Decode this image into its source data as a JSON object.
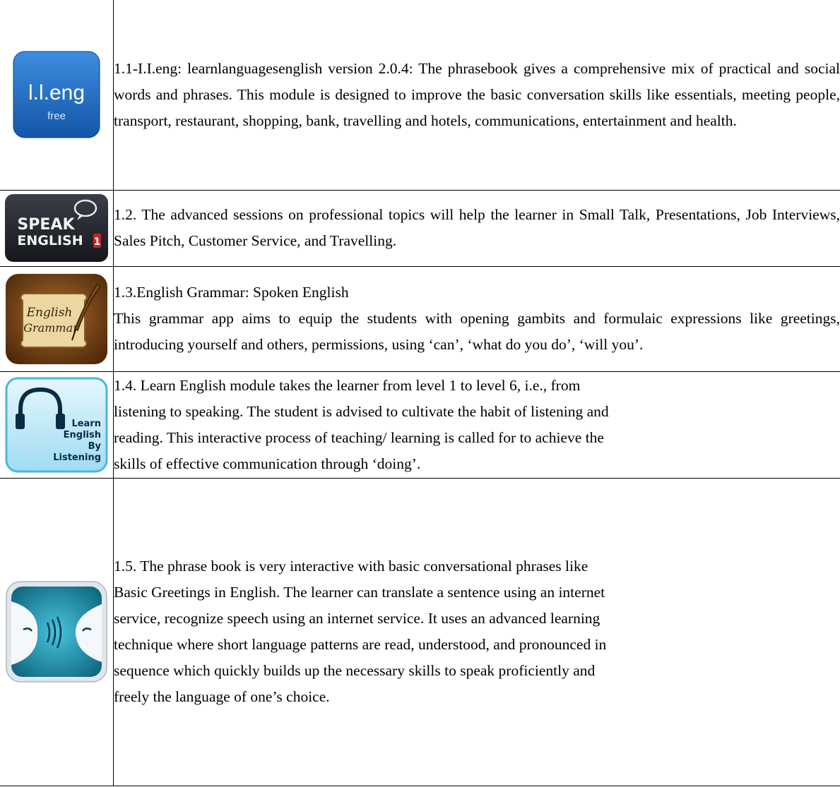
{
  "rows": [
    {
      "icon": "lleng-free-app-icon",
      "icon_title": "l.l.eng",
      "icon_subtitle": "free",
      "text_lines": [
        "1.1-I.I.eng: learnlanguagesenglish version 2.0.4: The phrasebook gives a comprehensive mix of practical and social words and phrases. This module is designed to improve the basic conversation skills like essentials, meeting people, transport, restaurant, shopping, bank, travelling and hotels, communications, entertainment and health."
      ]
    },
    {
      "icon": "speak-english-app-icon",
      "icon_line1": "SPEAK",
      "icon_line2": "ENGLISH",
      "icon_badge": "1",
      "text_lines": [
        "1.2. The advanced sessions on professional topics will help the learner in Small Talk, Presentations, Job Interviews, Sales Pitch, Customer Service, and Travelling."
      ]
    },
    {
      "icon": "english-grammar-scroll-app-icon",
      "icon_line1": "English",
      "icon_line2": "Grammar",
      "text_lines": [
        "1.3.English Grammar: Spoken English",
        "This grammar app aims to equip the students with opening gambits and formulaic expressions like greetings, introducing yourself and others, permissions, using ‘can’, ‘what do you do’, ‘will you’."
      ]
    },
    {
      "icon": "learn-english-by-listening-app-icon",
      "icon_line1": "Learn",
      "icon_line2": "English",
      "icon_line3": "By",
      "icon_line4": "Listening",
      "text_lines": [
        "1.4. Learn English module takes the learner from level 1 to level 6, i.e., from",
        "listening to speaking. The student is advised to cultivate the habit of listening and",
        "reading. This interactive process of teaching/ learning is called for to achieve the",
        "skills of effective communication through ‘doing’."
      ]
    },
    {
      "icon": "phrasebook-speech-app-icon",
      "text_lines": [
        "1.5. The phrase book is very interactive with basic conversational phrases like",
        "Basic Greetings in English. The learner can translate a sentence using an internet",
        "service, recognize speech using an internet service. It uses an advanced learning",
        "technique where short language patterns are read, understood, and pronounced in",
        "sequence which quickly builds up the necessary skills to speak proficiently and",
        "freely the language of one’s choice."
      ]
    }
  ],
  "colors": {
    "lleng_blue": "#1f6fc9",
    "speak_dark": "#23262e",
    "grammar_brown": "#6a3a12",
    "listening_cyan": "#59c6ea",
    "phrasebook_teal": "#1590a8"
  }
}
